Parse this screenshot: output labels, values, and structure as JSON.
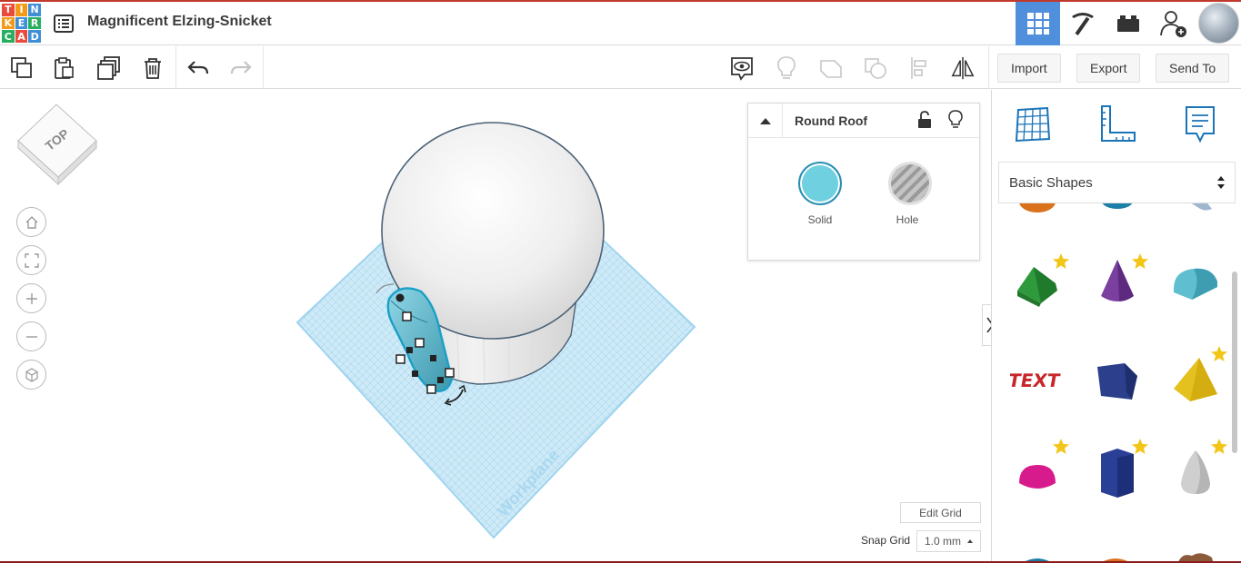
{
  "app": {
    "logo_letters": [
      "T",
      "I",
      "N",
      "K",
      "E",
      "R",
      "C",
      "A",
      "D"
    ],
    "logo_colors": [
      "#e94c3d",
      "#f39b19",
      "#3f8fd7",
      "#f39b19",
      "#3f8fd7",
      "#27ae60",
      "#27ae60",
      "#e94c3d",
      "#3f8fd7"
    ],
    "design_title": "Magnificent Elzing-Snicket"
  },
  "header": {
    "views": [
      {
        "name": "3d-design-grid-icon",
        "active": true
      },
      {
        "name": "pickaxe-icon",
        "active": false
      },
      {
        "name": "bricks-icon",
        "active": false
      },
      {
        "name": "add-user-icon",
        "active": false
      }
    ]
  },
  "toolbar": {
    "import_label": "Import",
    "export_label": "Export",
    "sendto_label": "Send To"
  },
  "viewcube": {
    "face_label": "TOP"
  },
  "inspector": {
    "shape_name": "Round Roof",
    "solid_label": "Solid",
    "hole_label": "Hole",
    "solid_color": "#6fd0e0"
  },
  "workplane": {
    "label": "Workplane",
    "edit_grid_label": "Edit Grid",
    "snap_grid_label": "Snap Grid",
    "snap_grid_value": "1.0 mm"
  },
  "shape_panel": {
    "category": "Basic Shapes",
    "shapes": [
      {
        "name": "wedge-shape",
        "color": "#2e9a3c",
        "starred": true
      },
      {
        "name": "cone-shape",
        "color": "#7b3fa0",
        "starred": true
      },
      {
        "name": "round-roof-shape",
        "color": "#5fbfd1",
        "starred": false
      },
      {
        "name": "text-shape",
        "color": "#c8262a",
        "starred": false,
        "text": "TEXT"
      },
      {
        "name": "polygon-shape",
        "color": "#2b3f8c",
        "starred": false
      },
      {
        "name": "pyramid-shape",
        "color": "#e5c11f",
        "starred": true
      },
      {
        "name": "half-sphere-shape",
        "color": "#d71b8c",
        "starred": true
      },
      {
        "name": "prism-shape",
        "color": "#2a3f96",
        "starred": true
      },
      {
        "name": "paraboloid-shape",
        "color": "#c8c8c8",
        "starred": true
      }
    ]
  }
}
